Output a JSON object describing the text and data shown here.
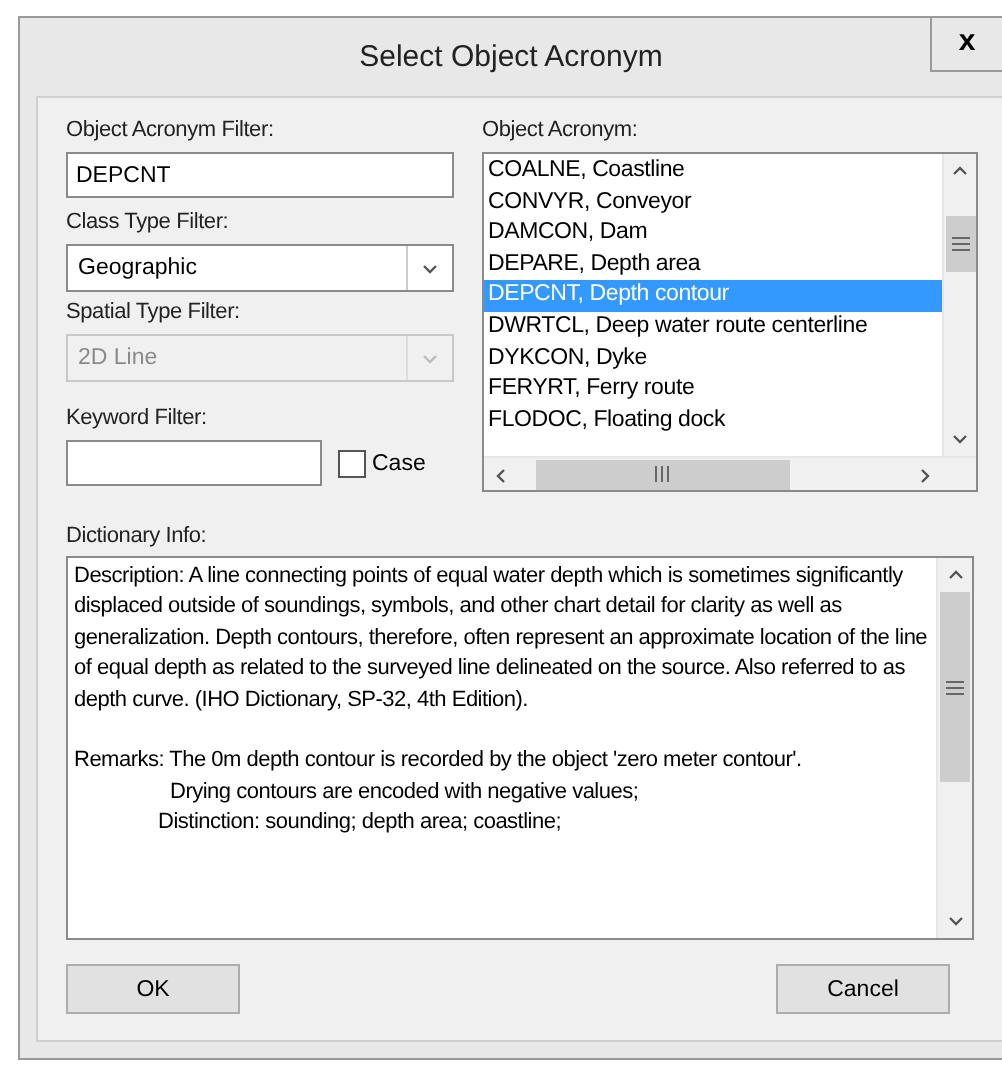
{
  "window": {
    "title": "Select Object Acronym",
    "close": "x"
  },
  "acronym_filter": {
    "label": "Object Acronym Filter:",
    "value": "DEPCNT"
  },
  "class_type_filter": {
    "label": "Class Type Filter:",
    "value": "Geographic",
    "disabled": false
  },
  "spatial_type_filter": {
    "label": "Spatial Type Filter:",
    "value": "2D Line",
    "disabled": true
  },
  "keyword_filter": {
    "label": "Keyword Filter:",
    "case_label": "Case",
    "case_checked": false
  },
  "object_acronym": {
    "label": "Object Acronym:",
    "items": [
      {
        "text": "COALNE, Coastline",
        "selected": false
      },
      {
        "text": "CONVYR, Conveyor",
        "selected": false
      },
      {
        "text": "DAMCON, Dam",
        "selected": false
      },
      {
        "text": "DEPARE, Depth area",
        "selected": false
      },
      {
        "text": "DEPCNT, Depth contour",
        "selected": true
      },
      {
        "text": "DWRTCL, Deep water route centerline",
        "selected": false
      },
      {
        "text": "DYKCON, Dyke",
        "selected": false
      },
      {
        "text": "FERYRT, Ferry route",
        "selected": false
      },
      {
        "text": "FLODOC, Floating dock",
        "selected": false
      }
    ]
  },
  "dictionary_info": {
    "label": "Dictionary Info:",
    "lines": [
      {
        "kind": "paragraph",
        "text": "Description: A line connecting points of equal water depth which is sometimes significantly displaced outside of soundings, symbols, and other chart detail for clarity as well as generalization. Depth contours, therefore, often represent an approximate location of the line of equal depth as related to the surveyed line delineated on the source. Also referred to as depth curve.  (IHO Dictionary, SP-32, 4th Edition)."
      },
      {
        "kind": "blank"
      },
      {
        "kind": "paragraph",
        "text": "Remarks: The 0m depth contour is recorded by the object 'zero meter contour'."
      },
      {
        "kind": "indent-wide",
        "text": "Drying contours are encoded with negative values;"
      },
      {
        "kind": "indent",
        "text": "Distinction: sounding; depth area; coastline;"
      }
    ]
  },
  "buttons": [
    "OK",
    "Cancel"
  ]
}
